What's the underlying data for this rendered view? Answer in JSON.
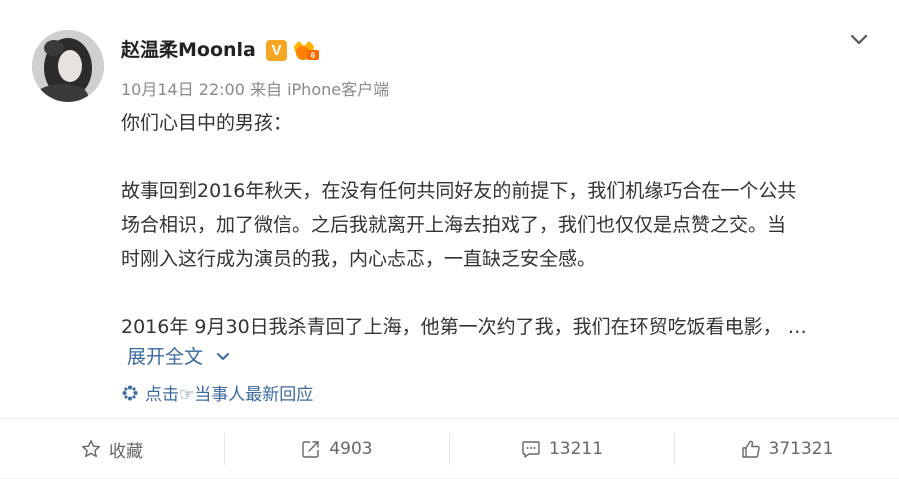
{
  "post": {
    "author_name": "赵温柔Moonla",
    "verified_badge": "V",
    "meta": "10月14日 22:00 来自 iPhone客户端",
    "paragraphs": [
      [
        "你们心目中的男孩："
      ],
      [],
      [
        "故事回到2016年秋天，在没有任何共同好友的前提下，我们机缘巧合在一个公共",
        "场合相识，加了微信。之后我就离开上海去拍戏了，我们也仅仅是点赞之交。当",
        "时刚入这行成为演员的我，内心忐忑，一直缺乏安全感。"
      ],
      [],
      [
        "2016年 9月30日我杀青回了上海，他第一次约了我，我们在环贸吃饭看电影， …"
      ]
    ],
    "expand_label": "展开全文",
    "respond_label": "点击☞当事人最新回应"
  },
  "footer": {
    "favorite_label": "收藏",
    "repost_count": "4903",
    "comment_count": "13211",
    "like_count": "371321"
  },
  "colors": {
    "link": "#3b6aa0",
    "verified": "#f5a623",
    "vip": "#ff8200"
  },
  "icons": [
    "avatar",
    "verified-icon",
    "vip-icon",
    "chevron-down-icon",
    "response-icon",
    "star-icon",
    "repost-icon",
    "comment-icon",
    "like-icon"
  ]
}
